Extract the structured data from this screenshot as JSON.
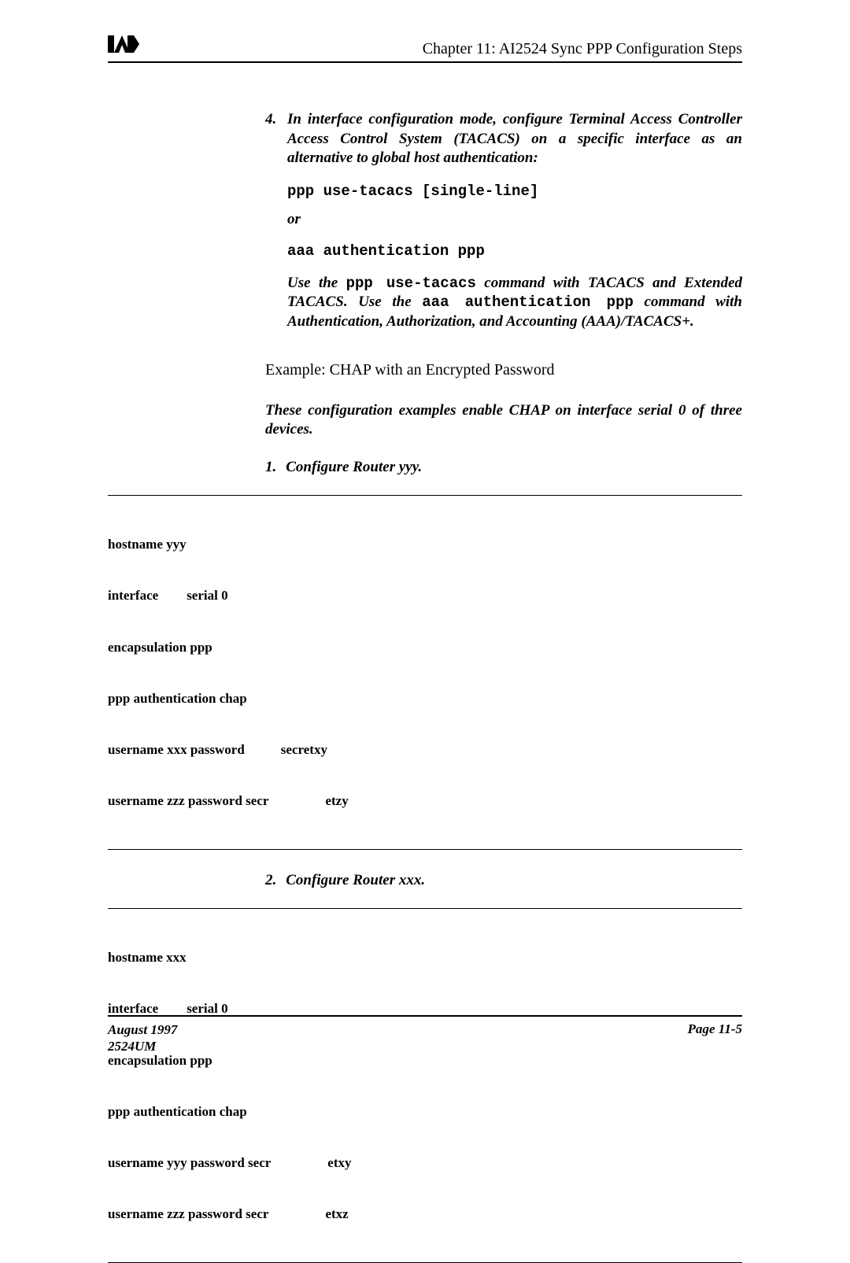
{
  "header": {
    "logo_text": "AI",
    "chapter": "Chapter 11: AI2524 Sync PPP Configuration Steps"
  },
  "step4": {
    "num": "4.",
    "text": "In interface configuration mode, configure Terminal Access Controller Access Control System (TACACS) on a specific interface as an alternative to global host authentication:"
  },
  "cmd1": "ppp use-tacacs [single-line]",
  "or": "or",
  "cmd2": "aaa authentication ppp",
  "note": {
    "p1a": "Use the ",
    "p1m": "ppp use-tacacs",
    "p1b": " command with TACACS and Extended TACACS. Use the ",
    "p2m": "aaa authentication ppp",
    "p2b": " command with Authentication, Authorization, and Accounting (AAA)/TACACS+."
  },
  "example_heading": "Example: CHAP with an Encrypted Password",
  "intro": "These configuration examples enable CHAP on interface serial 0 of three devices.",
  "steps": {
    "s1": {
      "num": "1.",
      "text": "Configure Router yyy."
    },
    "s2": {
      "num": "2.",
      "text": "Configure Router xxx."
    }
  },
  "code1": {
    "l1": "hostname yyy",
    "l2a": "interface",
    "l2b": "serial 0",
    "l3": "encapsulation ppp",
    "l4": "ppp authentication chap",
    "l5a": "username xxx password",
    "l5b": "secretxy",
    "l6a": "username zzz password secr",
    "l6b": "etzy"
  },
  "code2": {
    "l1": "hostname xxx",
    "l2a": "interface",
    "l2b": "serial 0",
    "l3": "encapsulation ppp",
    "l4": "ppp authentication chap",
    "l5a": "username yyy password secr",
    "l5b": "etxy",
    "l6a": "username zzz password secr",
    "l6b": "etxz"
  },
  "footer": {
    "date": "August 1997",
    "doc": "2524UM",
    "page": "Page 11-5"
  }
}
